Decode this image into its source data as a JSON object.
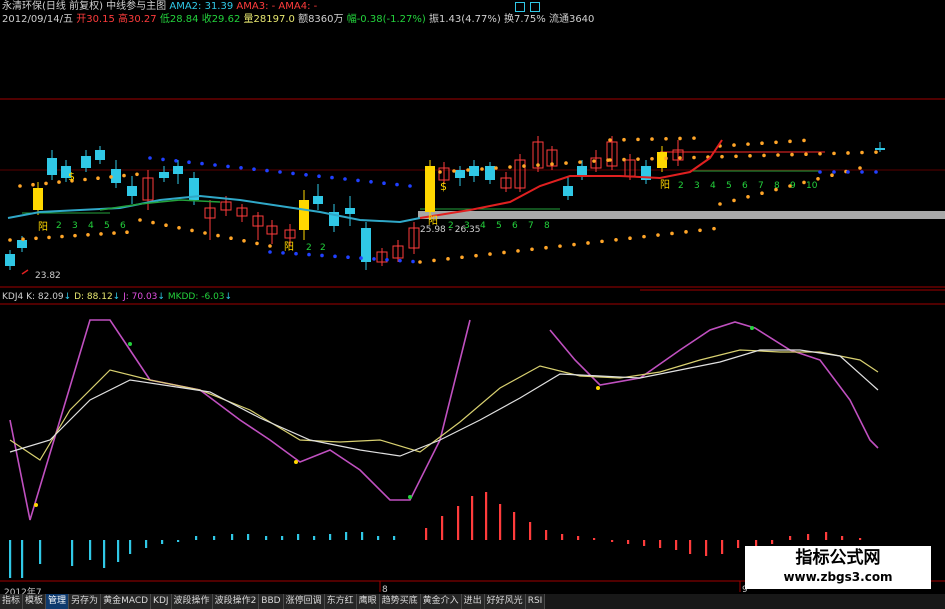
{
  "header": {
    "stock": "永清环保(日线 前复权)",
    "date": "2012/09/14/五",
    "open_label": "开",
    "open": "30.15",
    "high_label": "高",
    "high": "30.27",
    "low_label": "低",
    "low": "28.84",
    "close_label": "收",
    "close": "29.62",
    "vol_label": "量",
    "vol": "28197.0",
    "amount_label": "额",
    "amount": "8360万",
    "chg_label": "幅",
    "chg": "-0.38(-1.27%)",
    "amp_label": "振",
    "amp": "1.43(4.77%)",
    "turnover_label": "换",
    "turnover": "7.75%",
    "float_label": "流通",
    "float": "3640",
    "indicator": "中线参与主图",
    "ama2": "AMA2: 31.39",
    "ama3": "AMA3: -",
    "ama4": "AMA4: -"
  },
  "kdj": {
    "name": "KDJ4",
    "k": "K: 82.09",
    "d": "D: 88.12",
    "j": "J: 70.03",
    "mkdd": "MKDD: -6.03"
  },
  "price_labels": {
    "low_mark": "23.82",
    "range_label": "25.98 - 26.35",
    "yang1": "阳",
    "yang2": "阳",
    "yang3": "阳",
    "yang4": "阳",
    "s1": "$",
    "s2": "$"
  },
  "counts_a": [
    "2",
    "3",
    "4",
    "5",
    "6"
  ],
  "counts_b": [
    "2",
    "2"
  ],
  "counts_c": [
    "2",
    "3",
    "4",
    "5",
    "6",
    "7",
    "8"
  ],
  "counts_d": [
    "2",
    "3",
    "4",
    "5",
    "6",
    "7",
    "8",
    "9",
    "10"
  ],
  "axis": {
    "d1": "2012年7",
    "d2": "8",
    "d3": "9"
  },
  "tabs": [
    "指标",
    "模板",
    "管理",
    "另存为",
    "黄金MACD",
    "KDJ",
    "波段操作",
    "波段操作2",
    "BBD",
    "涨停回调",
    "东方红",
    "鹰眼",
    "趋势买底",
    "黄金介入",
    "进出",
    "好好风光",
    "RSI"
  ],
  "active_tab": "管理",
  "watermark": {
    "title": "指标公式网",
    "url": "www.zbgs3.com"
  },
  "colors": {
    "up": "#ff3c3c",
    "down": "#30c8e6",
    "yellow": "#ffd700",
    "k": "#c050c0",
    "d": "#e0e0e0",
    "j": "#d8d070",
    "ama": "#30c8e6"
  }
}
